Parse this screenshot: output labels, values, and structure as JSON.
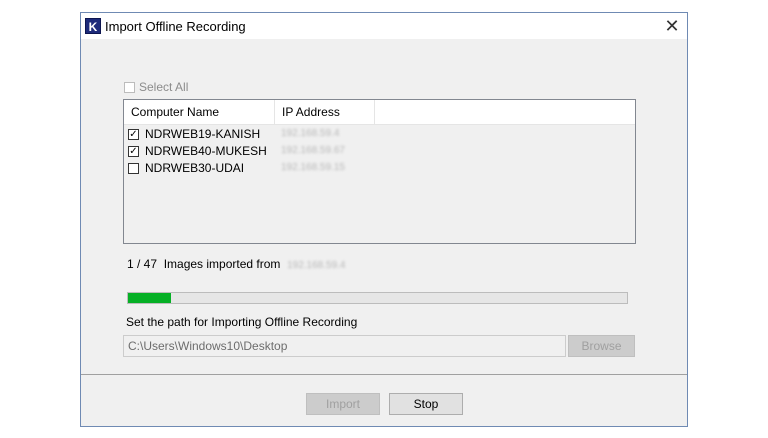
{
  "window": {
    "title": "Import Offline Recording",
    "app_icon_letter": "K",
    "close_glyph": "✕"
  },
  "select_all": {
    "label": "Select All",
    "checked": false,
    "enabled": false
  },
  "table": {
    "columns": [
      "Computer Name",
      "IP Address"
    ],
    "rows": [
      {
        "name": "NDRWEB19-KANISH",
        "ip": "192.168.59.4",
        "checked": true
      },
      {
        "name": "NDRWEB40-MUKESH",
        "ip": "192.168.59.67",
        "checked": true
      },
      {
        "name": "NDRWEB30-UDAI",
        "ip": "192.168.59.15",
        "checked": false
      }
    ]
  },
  "status": {
    "count_text": "1 / 47",
    "message": "Images imported from",
    "source_ip": "192.168.59.4"
  },
  "progress": {
    "fraction": 0.087,
    "color": "#06b025"
  },
  "path": {
    "label": "Set the path for Importing Offline Recording",
    "value": "C:\\Users\\Windows10\\Desktop",
    "browse_label": "Browse"
  },
  "buttons": {
    "import_label": "Import",
    "stop_label": "Stop"
  }
}
